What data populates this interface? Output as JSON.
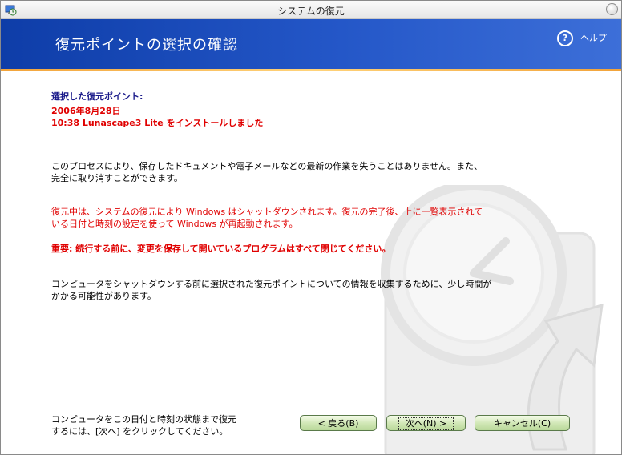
{
  "window": {
    "title": "システムの復元"
  },
  "header": {
    "title": "復元ポイントの選択の確認",
    "help_label": "ヘルプ"
  },
  "selected": {
    "label": "選択した復元ポイント:",
    "date": "2006年8月28日",
    "description": "10:38 Lunascape3 Lite をインストールしました"
  },
  "body": {
    "para1": "このプロセスにより、保存したドキュメントや電子メールなどの最新の作業を失うことはありません。また、完全に取り消すことができます。",
    "para2": "復元中は、システムの復元により Windows はシャットダウンされます。復元の完了後、上に一覧表示されている日付と時刻の設定を使って Windows が再起動されます。",
    "warning": "重要: 続行する前に、変更を保存して開いているプログラムはすべて閉じてください。",
    "para3": "コンピュータをシャットダウンする前に選択された復元ポイントについての情報を収集するために、少し時間がかかる可能性があります。"
  },
  "footer": {
    "note": "コンピュータをこの日付と時刻の状態まで復元するには、[次へ] をクリックしてください。",
    "back_label": "< 戻る(B)",
    "next_label": "次へ(N) >",
    "cancel_label": "キャンセル(C)"
  },
  "colors": {
    "header_blue": "#1e4fc0",
    "warning_red": "#e00000",
    "label_blue": "#1a1a8a",
    "button_green": "#cfe6b4"
  },
  "icons": {
    "app": "system-restore-icon",
    "help": "help-circle-icon",
    "close": "close-icon"
  }
}
